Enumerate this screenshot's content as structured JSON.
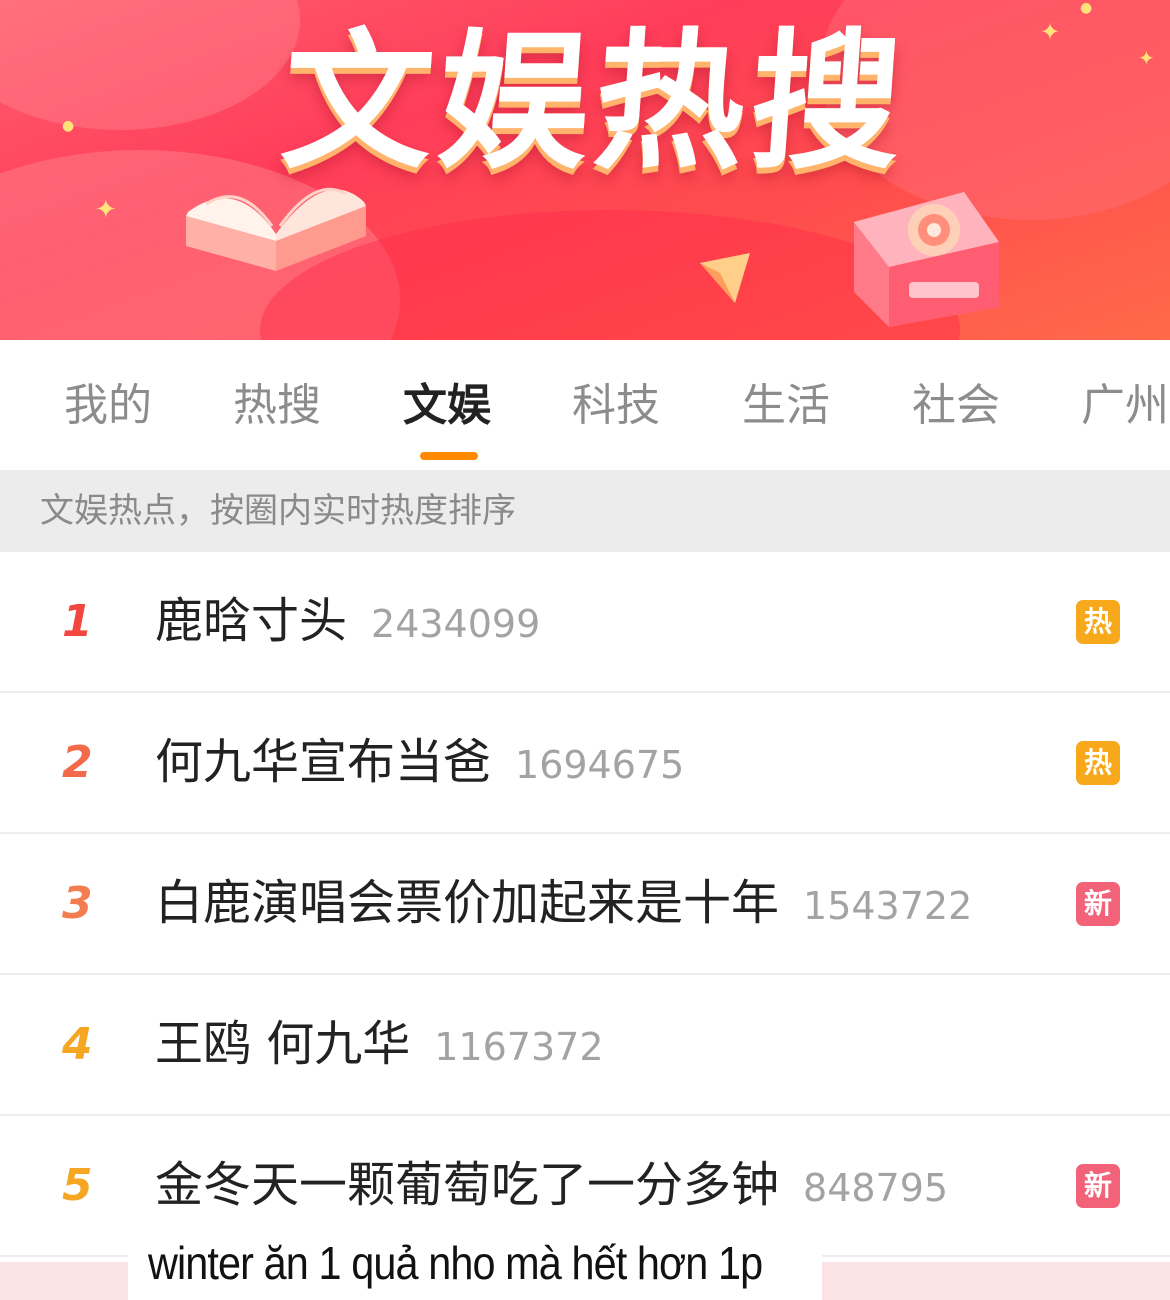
{
  "banner": {
    "title": "文娱热搜"
  },
  "tabs": [
    {
      "label": "我的",
      "active": false
    },
    {
      "label": "热搜",
      "active": false
    },
    {
      "label": "文娱",
      "active": true
    },
    {
      "label": "科技",
      "active": false
    },
    {
      "label": "生活",
      "active": false
    },
    {
      "label": "社会",
      "active": false
    },
    {
      "label": "广州",
      "active": false
    }
  ],
  "subtitle": "文娱热点，按圈内实时热度排序",
  "list": [
    {
      "rank": "1",
      "topic": "鹿晗寸头",
      "heat": "2434099",
      "badge": "热",
      "badge_color": "#f7a81b",
      "rank_color": "#f2463f"
    },
    {
      "rank": "2",
      "topic": "何九华宣布当爸",
      "heat": "1694675",
      "badge": "热",
      "badge_color": "#f7a81b",
      "rank_color": "#f36a4b"
    },
    {
      "rank": "3",
      "topic": "白鹿演唱会票价加起来是十年",
      "heat": "1543722",
      "badge": "新",
      "badge_color": "#f2637a",
      "rank_color": "#f47d4f"
    },
    {
      "rank": "4",
      "topic": "王鸥 何九华",
      "heat": "1167372",
      "badge": "",
      "badge_color": "",
      "rank_color": "#f5a623"
    },
    {
      "rank": "5",
      "topic": "金冬天一颗葡萄吃了一分多钟",
      "heat": "848795",
      "badge": "新",
      "badge_color": "#f2637a",
      "rank_color": "#f5a623"
    }
  ],
  "caption": "winter ăn 1 quả nho mà hết hơn 1p",
  "colors": {
    "accent": "#ff8a00",
    "badge_hot": "#f7a81b",
    "badge_new": "#f2637a",
    "banner": "#ff4d5e"
  }
}
